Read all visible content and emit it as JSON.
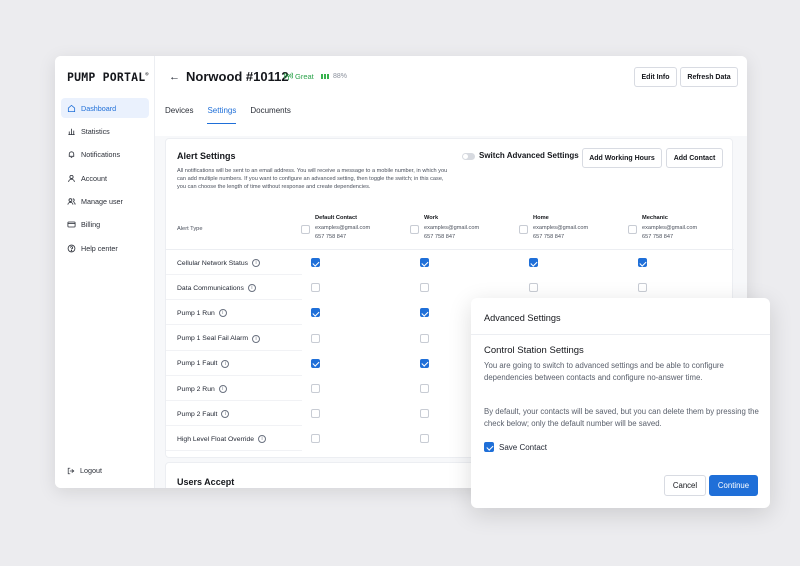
{
  "brand": {
    "logo_text": "PUMP PORTAL",
    "logo_mark": "®"
  },
  "sidebar": {
    "items": [
      {
        "label": "Dashboard",
        "icon": "home-icon",
        "active": true
      },
      {
        "label": "Statistics",
        "icon": "bar-chart-icon"
      },
      {
        "label": "Notifications",
        "icon": "bell-icon"
      },
      {
        "label": "Account",
        "icon": "user-icon"
      },
      {
        "label": "Manage user",
        "icon": "users-icon"
      },
      {
        "label": "Billing",
        "icon": "credit-card-icon"
      },
      {
        "label": "Help center",
        "icon": "help-circle-icon"
      }
    ],
    "logout_label": "Logout"
  },
  "header": {
    "back_icon": "arrow-left-icon",
    "title": "Norwood #10112",
    "signal_label": "Great",
    "battery_label": "88%",
    "edit_info": "Edit Info",
    "refresh_data": "Refresh Data"
  },
  "tabs": [
    {
      "label": "Devices"
    },
    {
      "label": "Settings",
      "active": true
    },
    {
      "label": "Documents"
    }
  ],
  "alert_settings": {
    "title": "Alert Settings",
    "description": "All notifications will be sent to an email address. You will receive a message to a mobile number, in which you can add multiple numbers. If you want to configure an advanced setting, then toggle the switch; in this case, you can choose the length of time without response and create dependencies.",
    "switch_label": "Switch Advanced Settings",
    "add_working_hours": "Add Working Hours",
    "add_contact": "Add Contact",
    "alert_type_header": "Alert Type",
    "contacts": [
      {
        "name": "Default Contact",
        "email": "examples@gmail.com",
        "phone": "657 758 847"
      },
      {
        "name": "Work",
        "email": "examples@gmail.com",
        "phone": "657 758 847"
      },
      {
        "name": "Home",
        "email": "examples@gmail.com",
        "phone": "657 758 847"
      },
      {
        "name": "Mechanic",
        "email": "examples@gmail.com",
        "phone": "657 758 847"
      }
    ],
    "rows": [
      {
        "label": "Cellular Network Status",
        "checks": [
          true,
          true,
          true,
          true
        ]
      },
      {
        "label": "Data Communications",
        "checks": [
          false,
          false,
          false,
          false
        ]
      },
      {
        "label": "Pump 1 Run",
        "checks": [
          true,
          true,
          false,
          false
        ]
      },
      {
        "label": "Pump 1 Seal Fail Alarm",
        "checks": [
          false,
          false,
          false,
          false
        ]
      },
      {
        "label": "Pump 1 Fault",
        "checks": [
          true,
          true,
          false,
          false
        ]
      },
      {
        "label": "Pump 2 Run",
        "checks": [
          false,
          false,
          false,
          false
        ]
      },
      {
        "label": "Pump 2 Fault",
        "checks": [
          false,
          false,
          false,
          false
        ]
      },
      {
        "label": "High Level Float Override",
        "checks": [
          false,
          false,
          false,
          false
        ]
      }
    ]
  },
  "users_accept": {
    "title": "Users Accept"
  },
  "modal": {
    "title": "Advanced Settings",
    "subtitle": "Control Station Settings",
    "paragraph1": "You are going to switch to advanced settings and be able to configure dependencies between contacts and configure no-answer time.",
    "paragraph2": "By default, your contacts will be saved, but you can delete them by pressing the check below; only the default number will be saved.",
    "checkbox_label": "Save Contact",
    "checkbox_checked": true,
    "cancel": "Cancel",
    "continue": "Continue"
  },
  "colors": {
    "accent": "#1f6fd8",
    "signal": "#2aa24a"
  }
}
